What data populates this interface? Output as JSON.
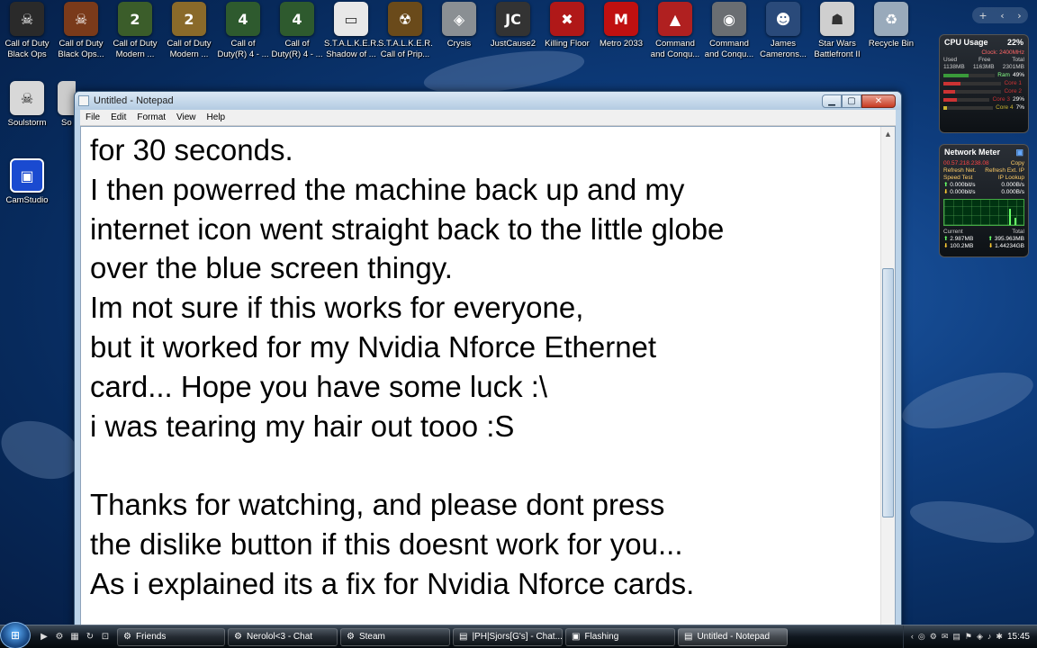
{
  "desktop": {
    "icons_row1": [
      {
        "label": "Call of Duty",
        "label2": "Black Ops",
        "glyph": "☠",
        "color": "#2a2a2a"
      },
      {
        "label": "Call of Duty",
        "label2": "Black Ops...",
        "glyph": "☠",
        "color": "#7a3a1a"
      },
      {
        "label": "Call of Duty",
        "label2": "Modern ...",
        "glyph": "2",
        "color": "#3b5d2a"
      },
      {
        "label": "Call of Duty",
        "label2": "Modern ...",
        "glyph": "2",
        "color": "#8a6a2a"
      },
      {
        "label": "Call of",
        "label2": "Duty(R) 4 - ...",
        "glyph": "4",
        "color": "#2e5a2e"
      },
      {
        "label": "Call of",
        "label2": "Duty(R) 4 - ...",
        "glyph": "4",
        "color": "#2e5a2e"
      },
      {
        "label": "S.T.A.L.K.E.R.",
        "label2": "Shadow of ...",
        "glyph": "▭",
        "color": "#e8e8e8"
      },
      {
        "label": "S.T.A.L.K.E.R.",
        "label2": "Call of Prip...",
        "glyph": "☢",
        "color": "#6a4a1a"
      },
      {
        "label": "Crysis",
        "label2": "",
        "glyph": "◈",
        "color": "#8a8f93"
      },
      {
        "label": "JustCause2",
        "label2": "",
        "glyph": "JC",
        "color": "#333"
      },
      {
        "label": "Killing Floor",
        "label2": "",
        "glyph": "✖",
        "color": "#b01818"
      },
      {
        "label": "Metro 2033",
        "label2": "",
        "glyph": "M",
        "color": "#c01010"
      },
      {
        "label": "Command",
        "label2": "and Conqu...",
        "glyph": "▲",
        "color": "#b02020"
      },
      {
        "label": "Command",
        "label2": "and Conqu...",
        "glyph": "◉",
        "color": "#6a6e72"
      },
      {
        "label": "James",
        "label2": "Camerons...",
        "glyph": "☻",
        "color": "#2a4a7a"
      },
      {
        "label": "Star Wars",
        "label2": "Battlefront II",
        "glyph": "☗",
        "color": "#cfcfcf"
      },
      {
        "label": "Recycle Bin",
        "label2": "",
        "glyph": "♻",
        "color": "#9ab"
      }
    ],
    "icons_col": [
      {
        "label": "Soulstorm",
        "glyph": "☠",
        "color": "#d8d8d8"
      },
      {
        "label": "CamStudio",
        "glyph": "▣",
        "color": "#1a4ad0"
      }
    ],
    "partial_label": "So"
  },
  "gadgets": {
    "controls": [
      "+",
      "‹",
      "›"
    ],
    "cpu": {
      "title": "CPU Usage",
      "percent": "22%",
      "clock": "Clock: 2400MHz",
      "mem_headers": [
        "Used",
        "Free",
        "Total"
      ],
      "mem_values": [
        "1138MB",
        "1163MB",
        "2301MB"
      ],
      "ram_label": "Ram",
      "ram_pct": "49%",
      "cores": [
        {
          "name": "Core 1",
          "pct": "",
          "level": 0.3,
          "color": "#c33"
        },
        {
          "name": "Core 2",
          "pct": "",
          "level": 0.2,
          "color": "#c33"
        },
        {
          "name": "Core 3",
          "pct": "29%",
          "level": 0.29,
          "color": "#c33"
        },
        {
          "name": "Core 4",
          "pct": "7%",
          "level": 0.07,
          "color": "#c9b430"
        }
      ]
    },
    "network": {
      "title": "Network Meter",
      "ip": "00.57.218.238.08",
      "copy": "Copy",
      "refresh_net": "Refresh Net.",
      "refresh_ext": "Refresh Ext. IP",
      "speed_test": "Speed Test",
      "ip_lookup": "IP Lookup",
      "up_rate": "0.000bit/s",
      "up_rate2": "0.000B/s",
      "down_rate": "0.000bit/s",
      "down_rate2": "0.000B/s",
      "current_label": "Current",
      "total_label": "Total",
      "cur_up": "2.987MB",
      "cur_down": "100.2MB",
      "tot_up": "395.963MB",
      "tot_down": "1.44234GB"
    }
  },
  "notepad": {
    "title": "Untitled - Notepad",
    "menu": [
      "File",
      "Edit",
      "Format",
      "View",
      "Help"
    ],
    "lines": [
      "for 30 seconds.",
      "I then powerred the machine back up and my",
      "internet icon went straight back to the little globe",
      "over the blue screen thingy.",
      "Im not sure if this works for everyone,",
      "but it worked for my Nvidia Nforce Ethernet",
      "card... Hope you have some luck :\\",
      "i was tearing my hair out tooo :S",
      "",
      "Thanks for watching, and please dont press",
      "the dislike button if this doesnt work for you...",
      "As i explained its a fix for Nvidia Nforce cards."
    ],
    "buttons": {
      "minimize": "▁",
      "maximize": "▢",
      "close": "✕"
    }
  },
  "taskbar": {
    "quick_launch": [
      "▶",
      "⚙",
      "▦",
      "↻",
      "⊡"
    ],
    "buttons": [
      {
        "label": "Friends",
        "icon": "⚙",
        "active": false
      },
      {
        "label": "Nerolol<3 - Chat",
        "icon": "⚙",
        "active": false
      },
      {
        "label": "Steam",
        "icon": "⚙",
        "active": false
      },
      {
        "label": "|PH|Sjors[G's] - Chat...",
        "icon": "▤",
        "active": false
      },
      {
        "label": "Flashing",
        "icon": "▣",
        "active": false
      },
      {
        "label": "Untitled - Notepad",
        "icon": "▤",
        "active": true
      }
    ],
    "tray_icons": [
      "‹",
      "◎",
      "⚙",
      "✉",
      "▤",
      "⚑",
      "◈",
      "♪",
      "✱"
    ],
    "clock": "15:45"
  }
}
